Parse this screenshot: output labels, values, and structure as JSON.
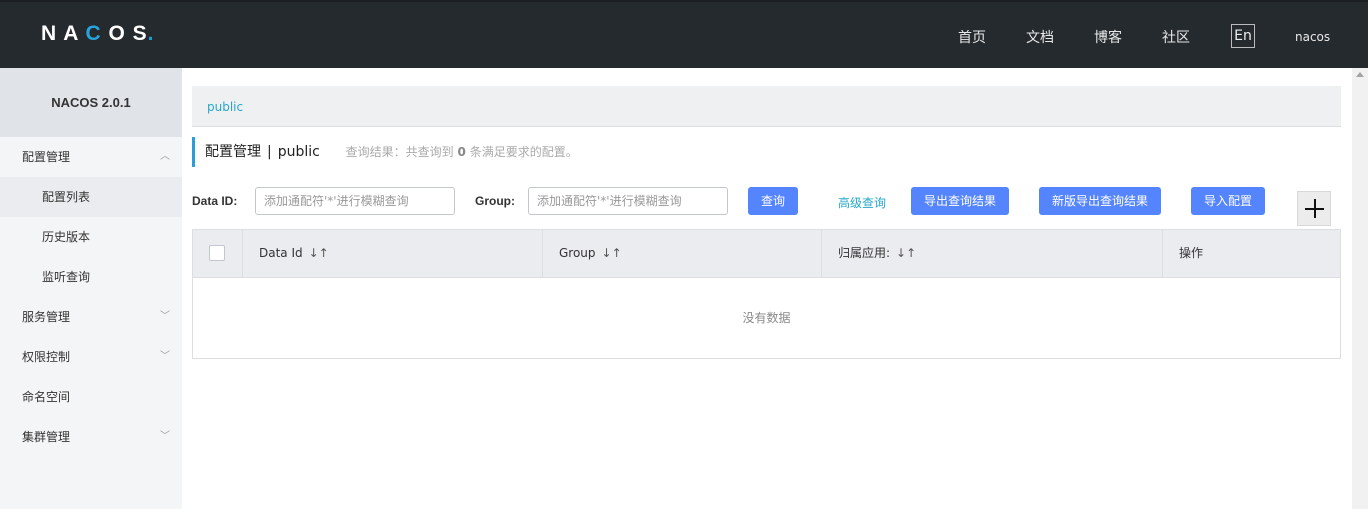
{
  "header": {
    "logo": "NACOS.",
    "nav": [
      "首页",
      "文档",
      "博客",
      "社区"
    ],
    "lang": "En",
    "user": "nacos"
  },
  "sidebar": {
    "version": "NACOS 2.0.1",
    "items": [
      {
        "label": "配置管理",
        "chevron": "︿"
      },
      {
        "label": "配置列表"
      },
      {
        "label": "历史版本"
      },
      {
        "label": "监听查询"
      },
      {
        "label": "服务管理",
        "chevron": "﹀"
      },
      {
        "label": "权限控制",
        "chevron": "﹀"
      },
      {
        "label": "命名空间"
      },
      {
        "label": "集群管理",
        "chevron": "﹀"
      }
    ]
  },
  "breadcrumb": "public",
  "title": {
    "main": "配置管理",
    "sep": "|",
    "namespace": "public",
    "result_prefix": "查询结果：共查询到",
    "result_count": "0",
    "result_suffix": "条满足要求的配置。"
  },
  "search": {
    "dataid_label": "Data ID:",
    "dataid_placeholder": "添加通配符'*'进行模糊查询",
    "group_label": "Group:",
    "group_placeholder": "添加通配符'*'进行模糊查询",
    "query_btn": "查询",
    "advanced_link": "高级查询",
    "export_btn": "导出查询结果",
    "new_export_btn": "新版导出查询结果",
    "import_btn": "导入配置"
  },
  "table": {
    "columns": [
      "Data Id",
      "Group",
      "归属应用:",
      "操作"
    ],
    "sort_icon": "↓↑",
    "empty": "没有数据"
  },
  "colors": {
    "header_bg": "#252a2f",
    "primary_btn": "#5584ff",
    "link": "#27a8c8"
  }
}
